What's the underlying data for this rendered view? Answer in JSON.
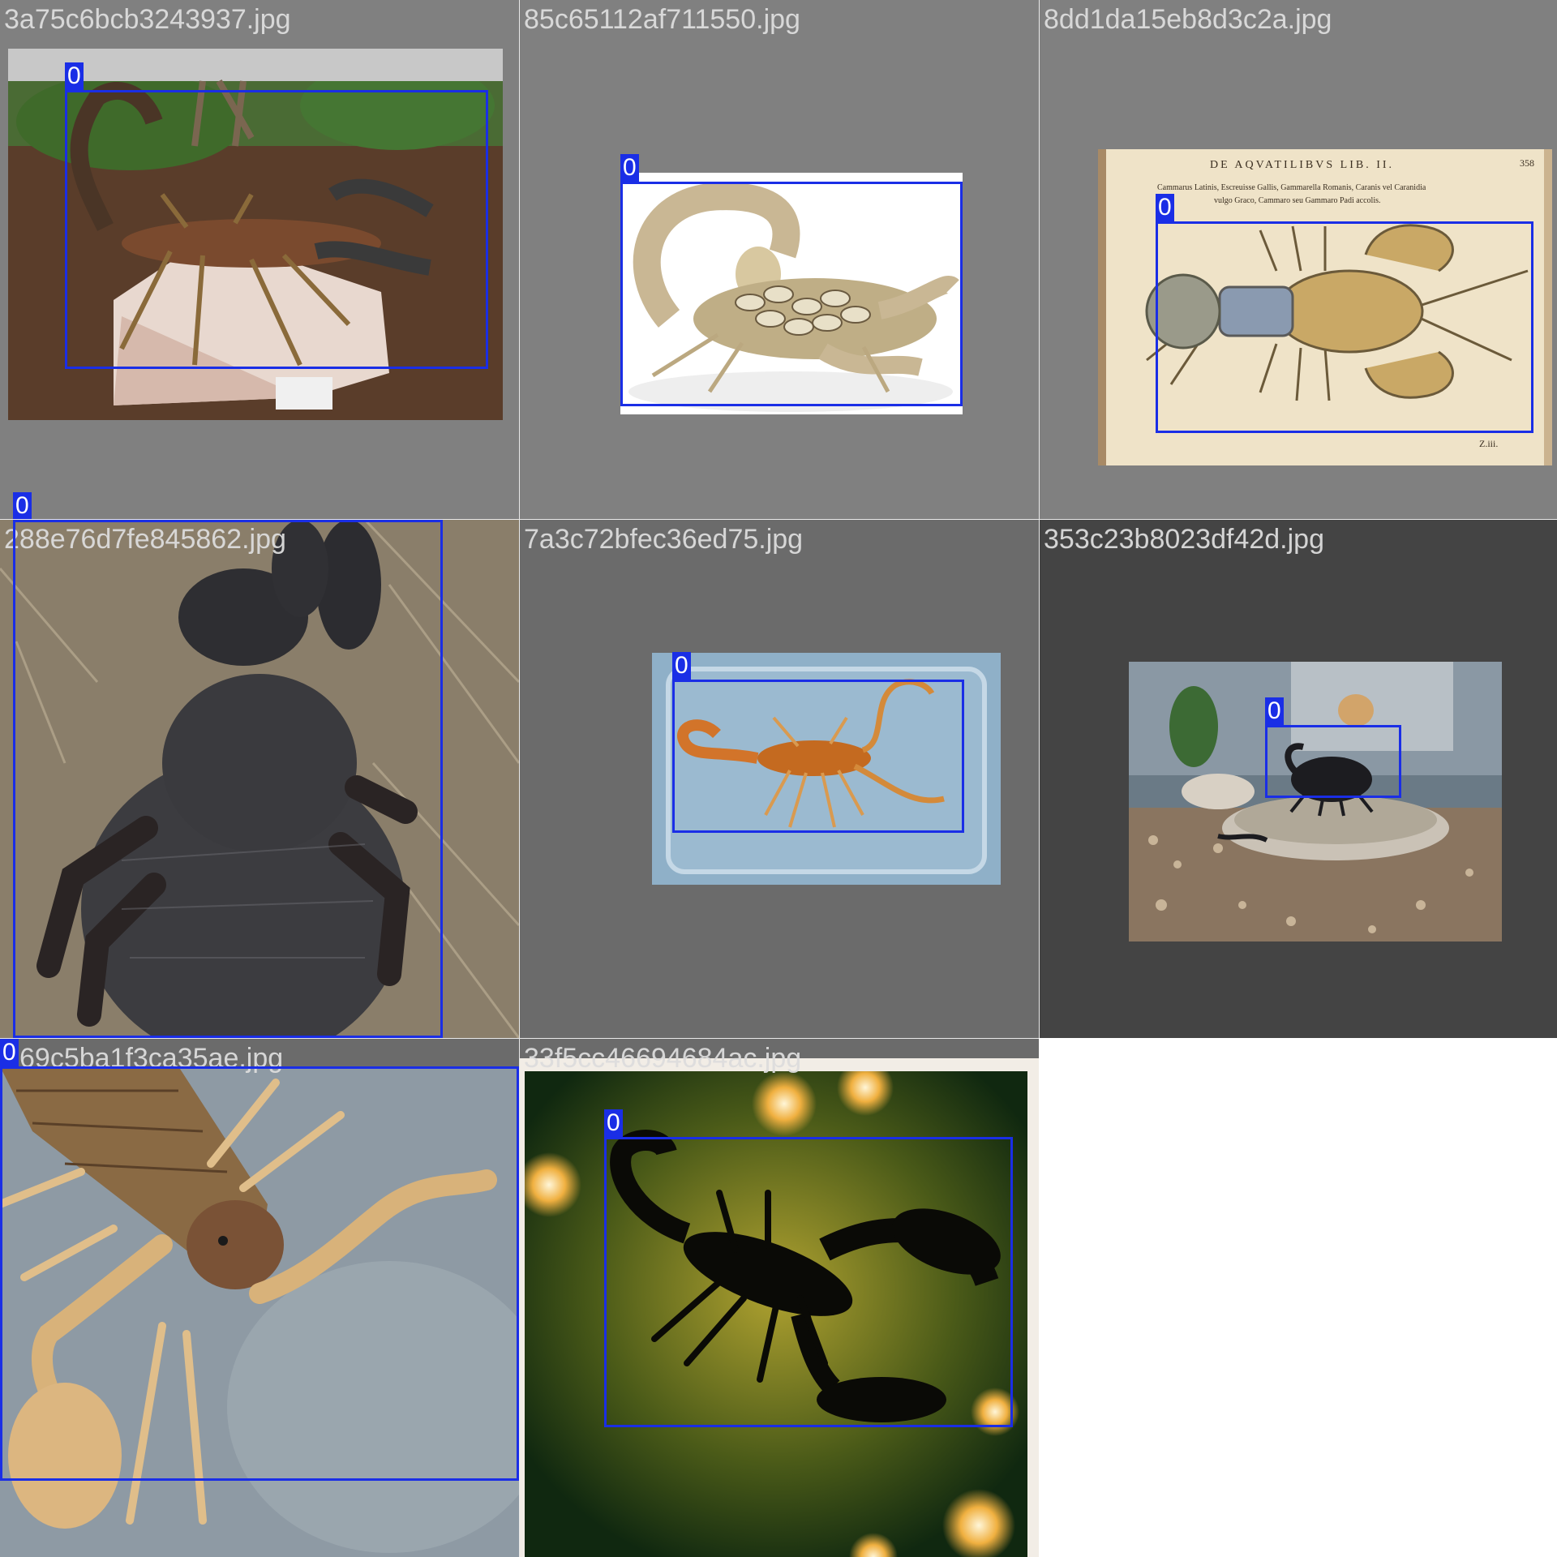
{
  "grid": {
    "background": "#ffffff",
    "cells": [
      {
        "filename": "3a75c6bcb3243937.jpg",
        "label": "0",
        "subject": "bronze scorpion sculpture on stone slab",
        "bg": "#808080"
      },
      {
        "filename": "85c65112af711550.jpg",
        "label": "0",
        "subject": "pale scorpion carrying babies",
        "bg": "#808080"
      },
      {
        "filename": "8dd1da15eb8d3c2a.jpg",
        "label": "0",
        "subject": "antique book illustration of crayfish",
        "bg": "#808080",
        "book_text": {
          "header": "DE AQVATILIBVS LIB. II.",
          "page": "358",
          "line1": "Cammarus Latinis, Escreuisse Gallis, Gammarella Romanis, Caranis vel Caranidia",
          "line2": "vulgo Graco, Cammaro seu Gammaro Padi accolis.",
          "footer": "Z.iii."
        }
      },
      {
        "filename": "288e76d7fe845862.jpg",
        "label": "0",
        "subject": "black scorpion close-up on bark",
        "bg": "#7a7060"
      },
      {
        "filename": "7a3c72bfec36ed75.jpg",
        "label": "0",
        "subject": "orange scorpion in plastic tub",
        "bg": "#6b6b6b"
      },
      {
        "filename": "353c23b8023df42d.jpg",
        "label": "0",
        "subject": "black scorpion in terrarium dish",
        "bg": "#444444"
      },
      {
        "filename": "69c5ba1f3ca35ae.jpg",
        "label": "0",
        "subject": "yellow scorpion close-up",
        "bg": "#6b6b6b"
      },
      {
        "filename": "33f5cc46694684ac.jpg",
        "label": "0",
        "subject": "scorpion silhouette with bokeh lights",
        "bg": "#6b6b6b"
      }
    ]
  },
  "colors": {
    "bbox": "#1a2ee6",
    "label_text": "#ffffff",
    "filename_text": "#dcdcdc"
  }
}
